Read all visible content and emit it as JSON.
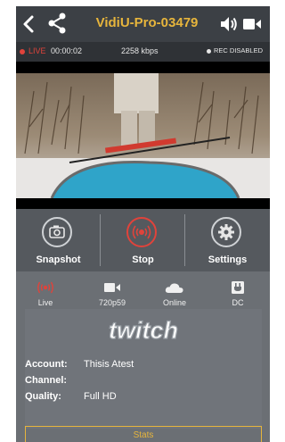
{
  "header": {
    "title": "VidiU-Pro-03479",
    "icons": {
      "back": "chevron-left-icon",
      "share": "share-icon",
      "volume": "volume-icon",
      "camera": "video-camera-icon"
    }
  },
  "status": {
    "live_label": "LIVE",
    "elapsed": "00:00:02",
    "bitrate": "2258 kbps",
    "rec_label": "REC DISABLED"
  },
  "controls": [
    {
      "label": "Snapshot",
      "icon": "camera-icon"
    },
    {
      "label": "Stop",
      "icon": "broadcast-icon"
    },
    {
      "label": "Settings",
      "icon": "gear-icon"
    }
  ],
  "indicators": [
    {
      "label": "Live",
      "icon": "broadcast-icon"
    },
    {
      "label": "720p59",
      "icon": "video-icon"
    },
    {
      "label": "Online",
      "icon": "cloud-icon"
    },
    {
      "label": "DC",
      "icon": "power-plug-icon"
    }
  ],
  "destination": {
    "logo_text": "twitch",
    "account_key": "Account:",
    "account_value": "Thisis Atest",
    "channel_key": "Channel:",
    "channel_value": "",
    "quality_key": "Quality:",
    "quality_value": "Full HD"
  },
  "stats_button": "Stats",
  "colors": {
    "accent": "#e7b53c",
    "live_red": "#e0433b",
    "panel": "#4b4f54"
  }
}
